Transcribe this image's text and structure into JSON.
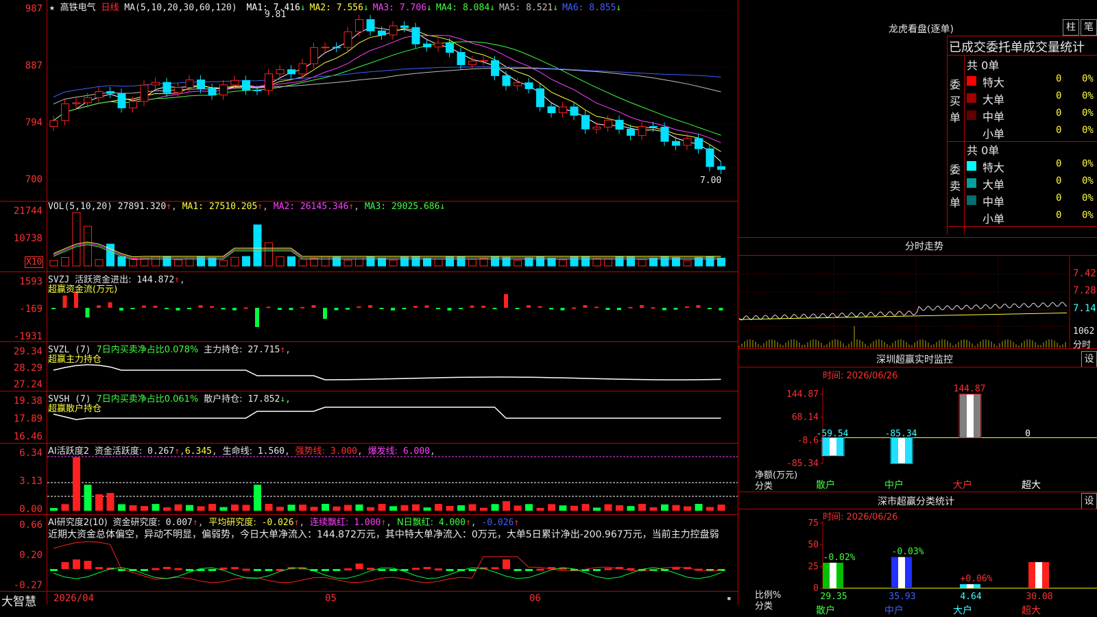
{
  "stock": {
    "star": "★",
    "name": "高铁电气",
    "period": "日线"
  },
  "price_panel": {
    "ma_label": "MA(5,10,20,30,60,120)",
    "ma": [
      {
        "label": "MA1:",
        "value": "7.416",
        "arrow": "↓",
        "color": "#ffffff"
      },
      {
        "label": "MA2:",
        "value": "7.556",
        "arrow": "↓",
        "color": "#ffff40"
      },
      {
        "label": "MA3:",
        "value": "7.706",
        "arrow": "↓",
        "color": "#ff40ff"
      },
      {
        "label": "MA4:",
        "value": "8.084",
        "arrow": "↓",
        "color": "#40ff40"
      },
      {
        "label": "MA5:",
        "value": "8.521",
        "arrow": "↓",
        "color": "#c0c0c0"
      },
      {
        "label": "MA6:",
        "value": "8.855",
        "arrow": "↓",
        "color": "#4060ff"
      }
    ],
    "y_ticks": [
      "987",
      "887",
      "794",
      "700"
    ],
    "high_label": "9.81",
    "low_label": "7.00"
  },
  "vol_panel": {
    "title": "VOL(5,10,20)",
    "value": "27891.320",
    "arrow": "↑",
    "ma": [
      {
        "label": "MA1:",
        "value": "27510.205",
        "arrow": "↑"
      },
      {
        "label": "MA2:",
        "value": "26145.346",
        "arrow": "↑"
      },
      {
        "label": "MA3:",
        "value": "29025.686",
        "arrow": "↓"
      }
    ],
    "y_ticks": [
      "21744",
      "10738"
    ],
    "unit": "X10"
  },
  "svzj_panel": {
    "title": "SVZJ",
    "label": "活跃资金进出:",
    "value": "144.872",
    "arrow": "↑",
    "sub": "超赢资金流(万元)",
    "y_ticks": [
      "1593",
      "-169",
      "-1931"
    ]
  },
  "svzl_panel": {
    "title": "SVZL (7)",
    "desc": "7日内买卖净占比0.078%",
    "label": "主力持仓:",
    "value": "27.715",
    "arrow": "↑",
    "sub": "超赢主力持仓",
    "y_ticks": [
      "29.34",
      "28.29",
      "27.24"
    ]
  },
  "svsh_panel": {
    "title": "SVSH (7)",
    "desc": "7日内买卖净占比0.061%",
    "label": "散户持仓:",
    "value": "17.852",
    "arrow": "↓",
    "sub": "超赢散户持仓",
    "y_ticks": [
      "19.38",
      "17.89",
      "16.46"
    ]
  },
  "ai1_panel": {
    "title": "AI活跃度2",
    "l1": "资金活跃度:",
    "v1": "0.267",
    "v2": "6.345",
    "l3": "生命线:",
    "v3": "1.560",
    "l4": "强势线:",
    "v4": "3.000",
    "l5": "爆发线:",
    "v5": "6.000",
    "y_ticks": [
      "6.34",
      "3.13",
      "0.00"
    ]
  },
  "ai2_panel": {
    "title": "AI研究度2(10)",
    "l1": "资金研究度:",
    "v1": "0.007",
    "l2": "平均研究度:",
    "v2": "-0.026",
    "l3": "连续飘红:",
    "v3": "1.000",
    "l4": "N日飘红:",
    "v4": "4.000",
    "v5": "-0.026",
    "note": "近期大资金总体偏空，异动不明显，偏弱势，今日大单净流入：144.872万元，其中特大单净流入：0万元，大单5日累计净出-200.967万元，当前主力控盘弱",
    "y_ticks": [
      "0.66",
      "0.20",
      "-0.27"
    ]
  },
  "bottom": {
    "brand": "大智慧",
    "dates": [
      "2026/04",
      "05",
      "06"
    ]
  },
  "lhb": {
    "title": "龙虎看盘(逐单)",
    "btn1": "柱",
    "btn2": "笔",
    "header": "已成交委托单成交量统计",
    "buy": {
      "side": "委买单",
      "total": "共 0单",
      "rows": [
        {
          "name": "特大",
          "count": "0",
          "pct": "0%",
          "color": "#ff0000"
        },
        {
          "name": "大单",
          "count": "0",
          "pct": "0%",
          "color": "#a00000"
        },
        {
          "name": "中单",
          "count": "0",
          "pct": "0%",
          "color": "#600000"
        },
        {
          "name": "小单",
          "count": "0",
          "pct": "0%",
          "color": "#000000"
        }
      ]
    },
    "sell": {
      "side": "委卖单",
      "total": "共 0单",
      "rows": [
        {
          "name": "特大",
          "count": "0",
          "pct": "0%",
          "color": "#00ffff"
        },
        {
          "name": "大单",
          "count": "0",
          "pct": "0%",
          "color": "#00a0a0"
        },
        {
          "name": "中单",
          "count": "0",
          "pct": "0%",
          "color": "#007070"
        },
        {
          "name": "小单",
          "count": "0",
          "pct": "0%",
          "color": "#000000"
        }
      ]
    }
  },
  "intraday": {
    "title": "分时走势",
    "y_ticks": [
      "7.42",
      "7.28",
      "7.14"
    ],
    "vol_tick": "1062",
    "vol_unit": "分时"
  },
  "monitor": {
    "title": "深圳超赢实时监控",
    "btn": "设",
    "time": "时间: 2026/06/26",
    "ylabel": "净额(万元)",
    "xlabel": "分类",
    "y_ticks": [
      "144.87",
      "68.14",
      "-8.6",
      "-85.34"
    ],
    "categories": [
      "散户",
      "中户",
      "大户",
      "超大"
    ],
    "values": [
      -59.54,
      -85.34,
      144.87,
      0
    ],
    "value_labels": [
      "-59.54",
      "-85.34",
      "144.87",
      "0"
    ]
  },
  "classify": {
    "title": "深市超赢分类统计",
    "btn": "设",
    "time": "时间: 2026/06/26",
    "ylabel": "比例%",
    "xlabel": "分类",
    "y_ticks": [
      "75",
      "50",
      "25",
      "0"
    ],
    "categories": [
      "散户",
      "中户",
      "大户",
      "超大"
    ],
    "values": [
      29.35,
      35.93,
      4.64,
      30.08
    ],
    "value_labels": [
      "29.35",
      "35.93",
      "4.64",
      "30.08"
    ],
    "changes": [
      "-0.02%",
      "-0.03%",
      "+0.06%",
      ""
    ]
  }
}
